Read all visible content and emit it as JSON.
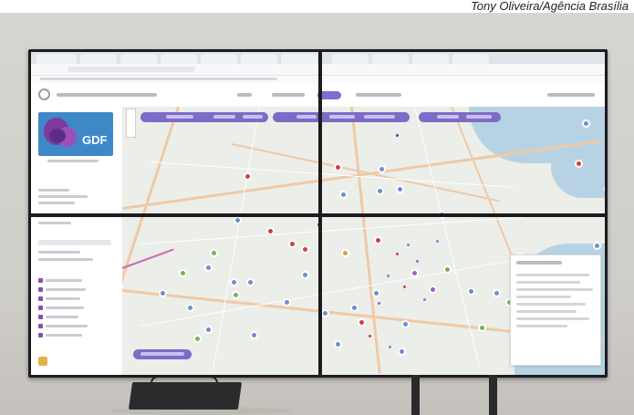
{
  "caption": {
    "credit": "Tony Oliveira/Agência Brasília"
  },
  "gdf_logo": {
    "text": "GDF"
  }
}
